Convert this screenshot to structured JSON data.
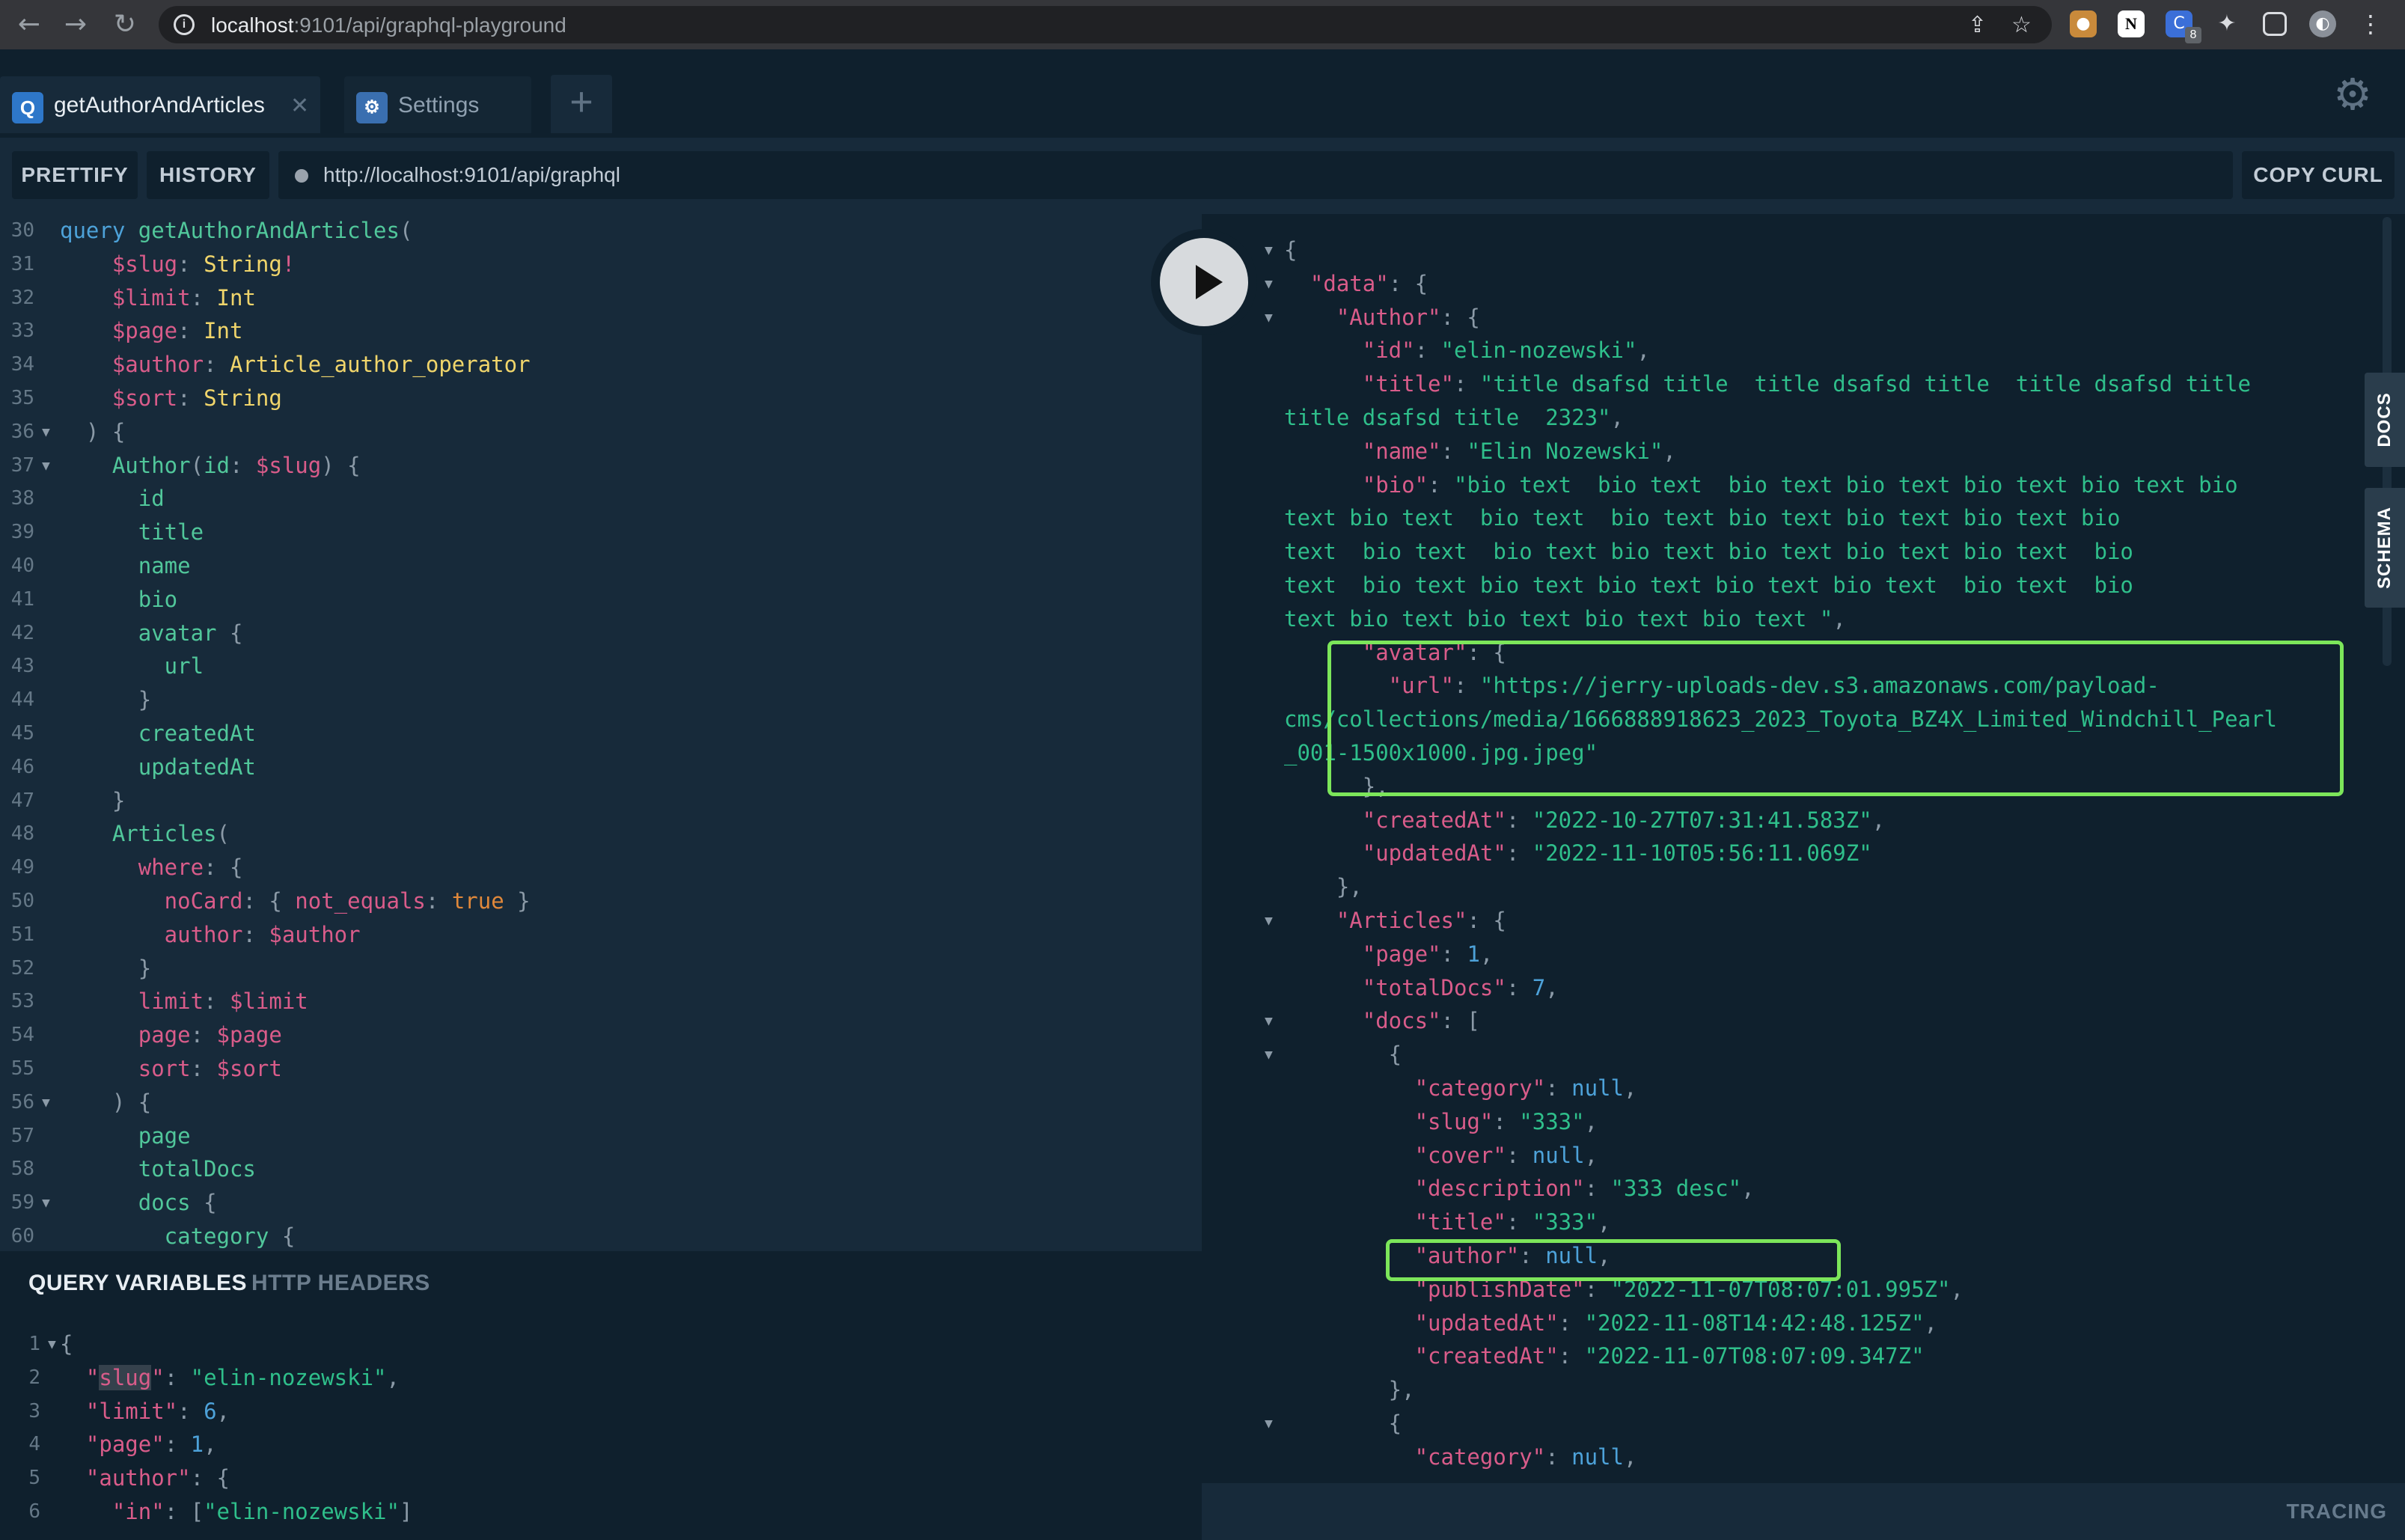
{
  "browser": {
    "url_host": "localhost",
    "url_rest": ":9101/api/graphql-playground",
    "extension_badge": "8"
  },
  "tabs": [
    {
      "badge": "Q",
      "label": "getAuthorAndArticles"
    },
    {
      "badge": "⚙",
      "label": "Settings"
    }
  ],
  "toolbar": {
    "prettify": "PRETTIFY",
    "history": "HISTORY",
    "endpoint": "http://localhost:9101/api/graphql",
    "copy_curl": "COPY CURL"
  },
  "editor_lines": [
    {
      "n": "30",
      "fold": false,
      "parts": [
        [
          "query ",
          "c-kw"
        ],
        [
          "getAuthorAndArticles",
          "c-def"
        ],
        [
          "(",
          "c-punc"
        ]
      ]
    },
    {
      "n": "31",
      "fold": false,
      "parts": [
        [
          "    $slug",
          "c-var"
        ],
        [
          ": ",
          "c-punc"
        ],
        [
          "String",
          "c-type"
        ],
        [
          "!",
          "c-var"
        ]
      ]
    },
    {
      "n": "32",
      "fold": false,
      "parts": [
        [
          "    $limit",
          "c-var"
        ],
        [
          ": ",
          "c-punc"
        ],
        [
          "Int",
          "c-type"
        ]
      ]
    },
    {
      "n": "33",
      "fold": false,
      "parts": [
        [
          "    $page",
          "c-var"
        ],
        [
          ": ",
          "c-punc"
        ],
        [
          "Int",
          "c-type"
        ]
      ]
    },
    {
      "n": "34",
      "fold": false,
      "parts": [
        [
          "    $author",
          "c-var"
        ],
        [
          ": ",
          "c-punc"
        ],
        [
          "Article_author_operator",
          "c-type"
        ]
      ]
    },
    {
      "n": "35",
      "fold": false,
      "parts": [
        [
          "    $sort",
          "c-var"
        ],
        [
          ": ",
          "c-punc"
        ],
        [
          "String",
          "c-type"
        ]
      ]
    },
    {
      "n": "36",
      "fold": true,
      "parts": [
        [
          "  ) {",
          "c-punc"
        ]
      ]
    },
    {
      "n": "37",
      "fold": true,
      "parts": [
        [
          "    Author",
          "c-def"
        ],
        [
          "(",
          "c-punc"
        ],
        [
          "id",
          "c-def"
        ],
        [
          ": ",
          "c-punc"
        ],
        [
          "$slug",
          "c-var"
        ],
        [
          ") {",
          "c-punc"
        ]
      ]
    },
    {
      "n": "38",
      "fold": false,
      "parts": [
        [
          "      id",
          "c-def"
        ]
      ]
    },
    {
      "n": "39",
      "fold": false,
      "parts": [
        [
          "      title",
          "c-def"
        ]
      ]
    },
    {
      "n": "40",
      "fold": false,
      "parts": [
        [
          "      name",
          "c-def"
        ]
      ]
    },
    {
      "n": "41",
      "fold": false,
      "parts": [
        [
          "      bio",
          "c-def"
        ]
      ]
    },
    {
      "n": "42",
      "fold": false,
      "parts": [
        [
          "      avatar",
          "c-def"
        ],
        [
          " {",
          "c-punc"
        ]
      ]
    },
    {
      "n": "43",
      "fold": false,
      "parts": [
        [
          "        url",
          "c-def"
        ]
      ]
    },
    {
      "n": "44",
      "fold": false,
      "parts": [
        [
          "      }",
          "c-punc"
        ]
      ]
    },
    {
      "n": "45",
      "fold": false,
      "parts": [
        [
          "      createdAt",
          "c-def"
        ]
      ]
    },
    {
      "n": "46",
      "fold": false,
      "parts": [
        [
          "      updatedAt",
          "c-def"
        ]
      ]
    },
    {
      "n": "47",
      "fold": false,
      "parts": [
        [
          "    }",
          "c-punc"
        ]
      ]
    },
    {
      "n": "48",
      "fold": false,
      "parts": [
        [
          "    Articles",
          "c-def"
        ],
        [
          "(",
          "c-punc"
        ]
      ]
    },
    {
      "n": "49",
      "fold": false,
      "parts": [
        [
          "      where",
          "c-prop"
        ],
        [
          ": {",
          "c-punc"
        ]
      ]
    },
    {
      "n": "50",
      "fold": false,
      "parts": [
        [
          "        noCard",
          "c-prop"
        ],
        [
          ": { ",
          "c-punc"
        ],
        [
          "not_equals",
          "c-prop"
        ],
        [
          ": ",
          "c-punc"
        ],
        [
          "true",
          "c-bool"
        ],
        [
          " }",
          "c-punc"
        ]
      ]
    },
    {
      "n": "51",
      "fold": false,
      "parts": [
        [
          "        author",
          "c-prop"
        ],
        [
          ": ",
          "c-punc"
        ],
        [
          "$author",
          "c-var"
        ]
      ]
    },
    {
      "n": "52",
      "fold": false,
      "parts": [
        [
          "      }",
          "c-punc"
        ]
      ]
    },
    {
      "n": "53",
      "fold": false,
      "parts": [
        [
          "      limit",
          "c-prop"
        ],
        [
          ": ",
          "c-punc"
        ],
        [
          "$limit",
          "c-var"
        ]
      ]
    },
    {
      "n": "54",
      "fold": false,
      "parts": [
        [
          "      page",
          "c-prop"
        ],
        [
          ": ",
          "c-punc"
        ],
        [
          "$page",
          "c-var"
        ]
      ]
    },
    {
      "n": "55",
      "fold": false,
      "parts": [
        [
          "      sort",
          "c-prop"
        ],
        [
          ": ",
          "c-punc"
        ],
        [
          "$sort",
          "c-var"
        ]
      ]
    },
    {
      "n": "56",
      "fold": true,
      "parts": [
        [
          "    ) {",
          "c-punc"
        ]
      ]
    },
    {
      "n": "57",
      "fold": false,
      "parts": [
        [
          "      page",
          "c-def"
        ]
      ]
    },
    {
      "n": "58",
      "fold": false,
      "parts": [
        [
          "      totalDocs",
          "c-def"
        ]
      ]
    },
    {
      "n": "59",
      "fold": true,
      "parts": [
        [
          "      docs",
          "c-def"
        ],
        [
          " {",
          "c-punc"
        ]
      ]
    },
    {
      "n": "60",
      "fold": false,
      "parts": [
        [
          "        category",
          "c-def"
        ],
        [
          " {",
          "c-punc"
        ]
      ]
    }
  ],
  "variables_header": {
    "query_variables": "QUERY VARIABLES",
    "http_headers": "HTTP HEADERS"
  },
  "variable_lines": [
    {
      "n": "1",
      "fold": true,
      "parts": [
        [
          "{",
          "c-punc"
        ]
      ]
    },
    {
      "n": "2",
      "fold": false,
      "parts": [
        [
          "  \"",
          "c-prop"
        ],
        [
          "slug",
          "c-prop hl"
        ],
        [
          "\"",
          "c-prop"
        ],
        [
          ": ",
          "c-punc"
        ],
        [
          "\"elin-nozewski\"",
          "c-str"
        ],
        [
          ",",
          "c-punc"
        ]
      ]
    },
    {
      "n": "3",
      "fold": false,
      "parts": [
        [
          "  \"limit\"",
          "c-prop"
        ],
        [
          ": ",
          "c-punc"
        ],
        [
          "6",
          "c-num"
        ],
        [
          ",",
          "c-punc"
        ]
      ]
    },
    {
      "n": "4",
      "fold": false,
      "parts": [
        [
          "  \"page\"",
          "c-prop"
        ],
        [
          ": ",
          "c-punc"
        ],
        [
          "1",
          "c-num"
        ],
        [
          ",",
          "c-punc"
        ]
      ]
    },
    {
      "n": "5",
      "fold": false,
      "parts": [
        [
          "  \"author\"",
          "c-prop"
        ],
        [
          ": {",
          "c-punc"
        ]
      ]
    },
    {
      "n": "6",
      "fold": false,
      "parts": [
        [
          "    \"in\"",
          "c-prop"
        ],
        [
          ": [",
          "c-punc"
        ],
        [
          "\"elin-nozewski\"",
          "c-str"
        ],
        [
          "]",
          "c-punc"
        ]
      ]
    }
  ],
  "result_lines": [
    {
      "fold": true,
      "parts": [
        [
          "{",
          "r-punc"
        ]
      ]
    },
    {
      "fold": true,
      "parts": [
        [
          "  \"data\"",
          "r-key"
        ],
        [
          ": {",
          "r-punc"
        ]
      ]
    },
    {
      "fold": true,
      "parts": [
        [
          "    \"Author\"",
          "r-key"
        ],
        [
          ": {",
          "r-punc"
        ]
      ]
    },
    {
      "fold": false,
      "parts": [
        [
          "      \"id\"",
          "r-key"
        ],
        [
          ": ",
          "r-punc"
        ],
        [
          "\"elin-nozewski\"",
          "r-str"
        ],
        [
          ",",
          "r-punc"
        ]
      ]
    },
    {
      "fold": false,
      "parts": [
        [
          "      \"title\"",
          "r-key"
        ],
        [
          ": ",
          "r-punc"
        ],
        [
          "\"title dsafsd title  title dsafsd title  title dsafsd title",
          "r-str"
        ]
      ]
    },
    {
      "fold": false,
      "parts": [
        [
          "title dsafsd title  2323\"",
          "r-str"
        ],
        [
          ",",
          "r-punc"
        ]
      ]
    },
    {
      "fold": false,
      "parts": [
        [
          "      \"name\"",
          "r-key"
        ],
        [
          ": ",
          "r-punc"
        ],
        [
          "\"Elin Nozewski\"",
          "r-str"
        ],
        [
          ",",
          "r-punc"
        ]
      ]
    },
    {
      "fold": false,
      "parts": [
        [
          "      \"bio\"",
          "r-key"
        ],
        [
          ": ",
          "r-punc"
        ],
        [
          "\"bio text  bio text  bio text bio text bio text bio text bio",
          "r-str"
        ]
      ]
    },
    {
      "fold": false,
      "parts": [
        [
          "text bio text  bio text  bio text bio text bio text bio text bio",
          "r-str"
        ]
      ]
    },
    {
      "fold": false,
      "parts": [
        [
          "text  bio text  bio text bio text bio text bio text bio text  bio",
          "r-str"
        ]
      ]
    },
    {
      "fold": false,
      "parts": [
        [
          "text  bio text bio text bio text bio text bio text  bio text  bio",
          "r-str"
        ]
      ]
    },
    {
      "fold": false,
      "parts": [
        [
          "text bio text bio text bio text bio text \"",
          "r-str"
        ],
        [
          ",",
          "r-punc"
        ]
      ]
    },
    {
      "fold": false,
      "parts": [
        [
          "      \"avatar\"",
          "r-key"
        ],
        [
          ": {",
          "r-punc"
        ]
      ]
    },
    {
      "fold": false,
      "parts": [
        [
          "        \"url\"",
          "r-key"
        ],
        [
          ": ",
          "r-punc"
        ],
        [
          "\"https://jerry-uploads-dev.s3.amazonaws.com/payload-",
          "r-str"
        ]
      ]
    },
    {
      "fold": false,
      "parts": [
        [
          "cms/collections/media/1666888918623_2023_Toyota_BZ4X_Limited_Windchill_Pearl",
          "r-str"
        ]
      ]
    },
    {
      "fold": false,
      "parts": [
        [
          "_001-1500x1000.jpg.jpeg\"",
          "r-str"
        ]
      ]
    },
    {
      "fold": false,
      "parts": [
        [
          "      },",
          "r-punc"
        ]
      ]
    },
    {
      "fold": false,
      "parts": [
        [
          "      \"createdAt\"",
          "r-key"
        ],
        [
          ": ",
          "r-punc"
        ],
        [
          "\"2022-10-27T07:31:41.583Z\"",
          "r-str"
        ],
        [
          ",",
          "r-punc"
        ]
      ]
    },
    {
      "fold": false,
      "parts": [
        [
          "      \"updatedAt\"",
          "r-key"
        ],
        [
          ": ",
          "r-punc"
        ],
        [
          "\"2022-11-10T05:56:11.069Z\"",
          "r-str"
        ]
      ]
    },
    {
      "fold": false,
      "parts": [
        [
          "    },",
          "r-punc"
        ]
      ]
    },
    {
      "fold": true,
      "parts": [
        [
          "    \"Articles\"",
          "r-key"
        ],
        [
          ": {",
          "r-punc"
        ]
      ]
    },
    {
      "fold": false,
      "parts": [
        [
          "      \"page\"",
          "r-key"
        ],
        [
          ": ",
          "r-punc"
        ],
        [
          "1",
          "r-num"
        ],
        [
          ",",
          "r-punc"
        ]
      ]
    },
    {
      "fold": false,
      "parts": [
        [
          "      \"totalDocs\"",
          "r-key"
        ],
        [
          ": ",
          "r-punc"
        ],
        [
          "7",
          "r-num"
        ],
        [
          ",",
          "r-punc"
        ]
      ]
    },
    {
      "fold": true,
      "parts": [
        [
          "      \"docs\"",
          "r-key"
        ],
        [
          ": [",
          "r-punc"
        ]
      ]
    },
    {
      "fold": true,
      "parts": [
        [
          "        {",
          "r-punc"
        ]
      ]
    },
    {
      "fold": false,
      "parts": [
        [
          "          \"category\"",
          "r-key"
        ],
        [
          ": ",
          "r-punc"
        ],
        [
          "null",
          "r-null"
        ],
        [
          ",",
          "r-punc"
        ]
      ]
    },
    {
      "fold": false,
      "parts": [
        [
          "          \"slug\"",
          "r-key"
        ],
        [
          ": ",
          "r-punc"
        ],
        [
          "\"333\"",
          "r-str"
        ],
        [
          ",",
          "r-punc"
        ]
      ]
    },
    {
      "fold": false,
      "parts": [
        [
          "          \"cover\"",
          "r-key"
        ],
        [
          ": ",
          "r-punc"
        ],
        [
          "null",
          "r-null"
        ],
        [
          ",",
          "r-punc"
        ]
      ]
    },
    {
      "fold": false,
      "parts": [
        [
          "          \"description\"",
          "r-key"
        ],
        [
          ": ",
          "r-punc"
        ],
        [
          "\"333 desc\"",
          "r-str"
        ],
        [
          ",",
          "r-punc"
        ]
      ]
    },
    {
      "fold": false,
      "parts": [
        [
          "          \"title\"",
          "r-key"
        ],
        [
          ": ",
          "r-punc"
        ],
        [
          "\"333\"",
          "r-str"
        ],
        [
          ",",
          "r-punc"
        ]
      ]
    },
    {
      "fold": false,
      "parts": [
        [
          "          \"author\"",
          "r-key"
        ],
        [
          ": ",
          "r-punc"
        ],
        [
          "null",
          "r-null"
        ],
        [
          ",",
          "r-punc"
        ]
      ]
    },
    {
      "fold": false,
      "parts": [
        [
          "          \"publishDate\"",
          "r-key"
        ],
        [
          ": ",
          "r-punc"
        ],
        [
          "\"2022-11-07T08:07:01.995Z\"",
          "r-str"
        ],
        [
          ",",
          "r-punc"
        ]
      ]
    },
    {
      "fold": false,
      "parts": [
        [
          "          \"updatedAt\"",
          "r-key"
        ],
        [
          ": ",
          "r-punc"
        ],
        [
          "\"2022-11-08T14:42:48.125Z\"",
          "r-str"
        ],
        [
          ",",
          "r-punc"
        ]
      ]
    },
    {
      "fold": false,
      "parts": [
        [
          "          \"createdAt\"",
          "r-key"
        ],
        [
          ": ",
          "r-punc"
        ],
        [
          "\"2022-11-07T08:07:09.347Z\"",
          "r-str"
        ]
      ]
    },
    {
      "fold": false,
      "parts": [
        [
          "        },",
          "r-punc"
        ]
      ]
    },
    {
      "fold": true,
      "parts": [
        [
          "        {",
          "r-punc"
        ]
      ]
    },
    {
      "fold": false,
      "parts": [
        [
          "          \"category\"",
          "r-key"
        ],
        [
          ": ",
          "r-punc"
        ],
        [
          "null",
          "r-null"
        ],
        [
          ",",
          "r-punc"
        ]
      ]
    }
  ],
  "side_tabs": {
    "docs": "DOCS",
    "schema": "SCHEMA"
  },
  "footer": {
    "tracing": "TRACING"
  },
  "colors": {
    "accent_highlight": "#7ce65a",
    "panel_dark": "#0f202d",
    "panel": "#172a3a"
  }
}
